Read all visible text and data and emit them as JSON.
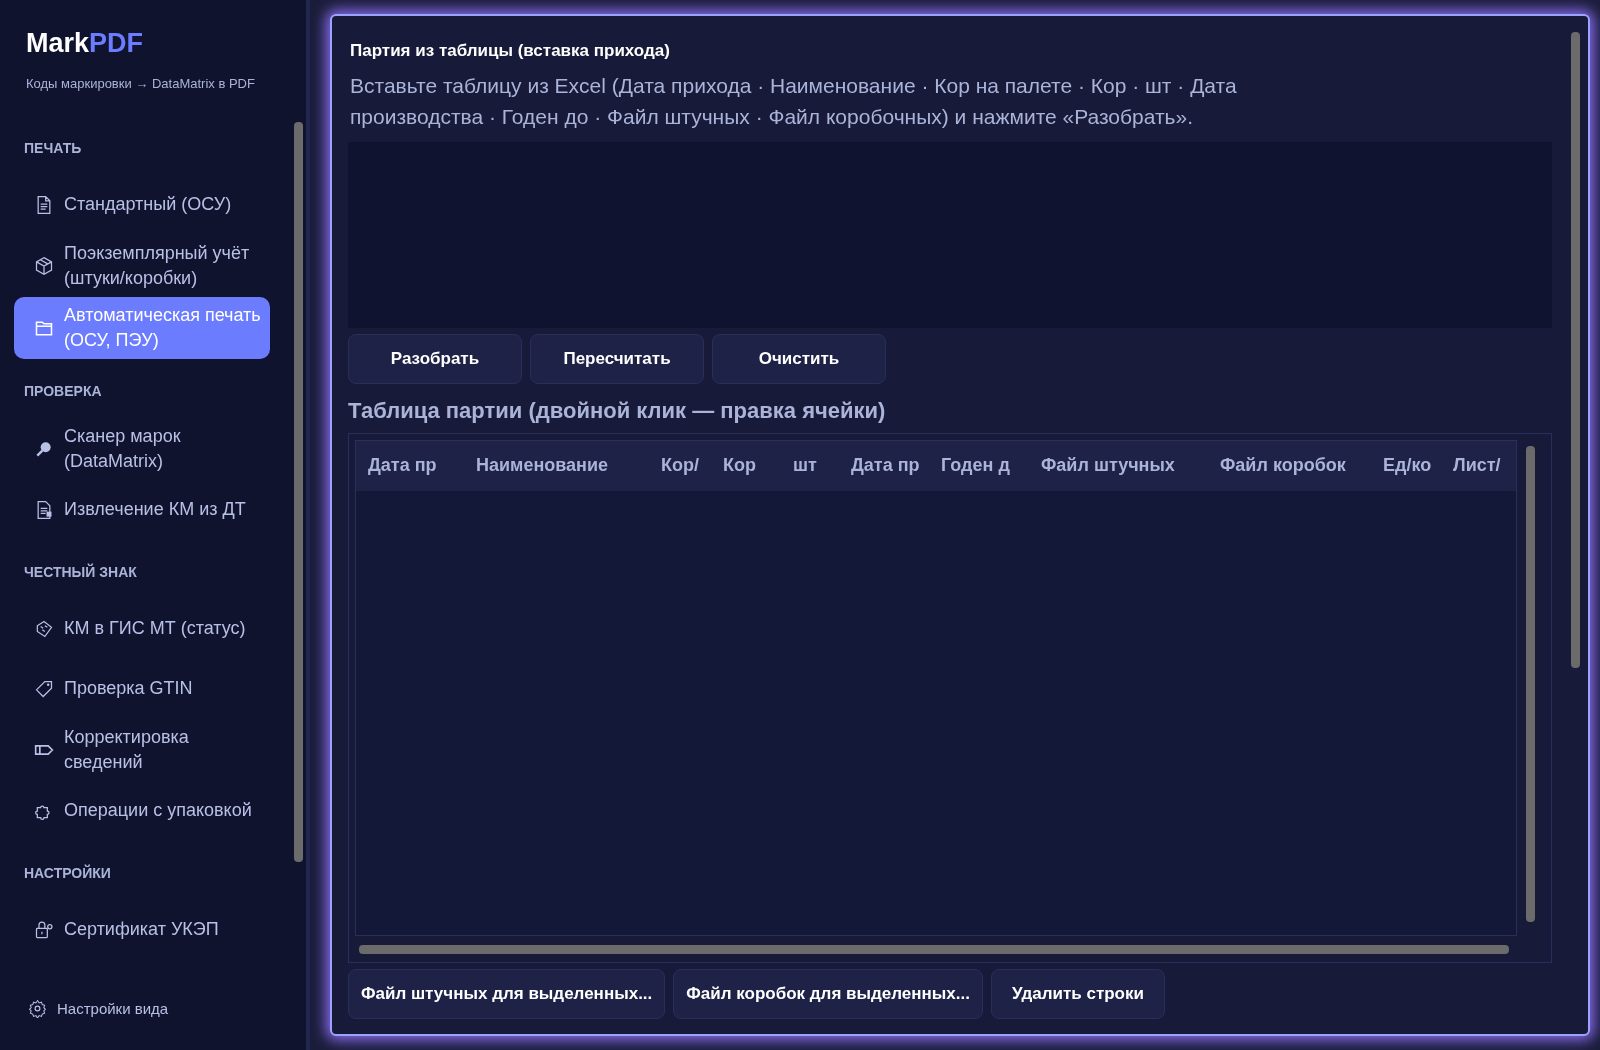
{
  "sidebar": {
    "logo": {
      "part_1": "Mark",
      "part_2": "PDF"
    },
    "subtitle": "Коды маркировки → DataMatrix в PDF",
    "sections": [
      {
        "title": "ПЕЧАТЬ",
        "items": [
          {
            "label": "Стандартный (ОСУ)",
            "selected": false
          },
          {
            "label": "Поэкземплярный учёт (штуки/коробки)",
            "selected": false
          },
          {
            "label": "Автоматическая печать (ОСУ, ПЭУ)",
            "selected": true
          }
        ]
      },
      {
        "title": "ПРОВЕРКА",
        "items": [
          {
            "label": "Сканер марок (DataMatrix)",
            "selected": false
          },
          {
            "label": "Извлечение КМ из ДТ",
            "selected": false
          }
        ]
      },
      {
        "title": "ЧЕСТНЫЙ ЗНАК",
        "items": [
          {
            "label": "КМ в ГИС МТ (статус)",
            "selected": false
          },
          {
            "label": "Проверка GTIN",
            "selected": false
          },
          {
            "label": "Корректировка сведений",
            "selected": false
          },
          {
            "label": "Операции с упаковкой",
            "selected": false
          }
        ]
      },
      {
        "title": "НАСТРОЙКИ",
        "items": [
          {
            "label": "Сертификат УКЭП",
            "selected": false
          }
        ]
      }
    ],
    "footer": "Настройки вида"
  },
  "main": {
    "title": "Партия из таблицы (вставка прихода)",
    "description": "Вставьте таблицу из Excel (Дата прихода · Наименование · Кор на палете · Кор · шт · Дата производства · Годен до · Файл штучных · Файл коробочных) и нажмите «Разобрать».",
    "actions": [
      "Разобрать",
      "Пересчитать",
      "Очистить"
    ],
    "table_title": "Таблица партии (двойной клик — правка ячейки)",
    "table": {
      "columns": [
        "Дата пр",
        "Наименование",
        "Кор/",
        "Кор",
        "шт",
        "Дата пр",
        "Годен д",
        "Файл штучных",
        "Файл коробок",
        "Ед/ко",
        "Лист/"
      ]
    },
    "bottom_actions": [
      "Файл штучных для выделенных...",
      "Файл коробок для выделенных...",
      "Удалить строки"
    ]
  }
}
